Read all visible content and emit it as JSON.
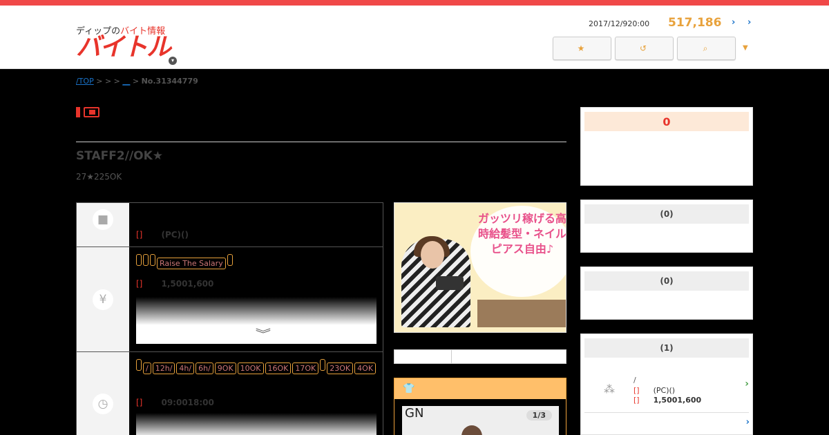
{
  "header": {
    "logo_sub_prefix": "ディップの",
    "logo_sub_red": "バイト情報",
    "logo_main": "バイトル",
    "date": "2017/12/920:00",
    "count": "517,186",
    "buttons": [
      {
        "label": "",
        "icon": "star-icon"
      },
      {
        "label": "",
        "icon": "history-icon"
      },
      {
        "label": "",
        "icon": "search-icon"
      }
    ]
  },
  "breadcrumb": {
    "top": "/TOP",
    "sep": ">",
    "link": "__",
    "current": "No.31344779"
  },
  "job": {
    "title": "STAFF2//OK★",
    "subtitle": "27★225OK"
  },
  "info_rows": {
    "type": {
      "label": "[]",
      "value": "(PC)()"
    },
    "salary": {
      "tags": [
        "",
        "",
        "",
        "Raise The Salary",
        ""
      ],
      "label": "[]",
      "value": "1,5001,600"
    },
    "time": {
      "tags": [
        "",
        "/",
        "12h/",
        "4h/",
        "6h/",
        "9OK",
        "10OK",
        "16OK",
        "17OK",
        "",
        "23OK",
        "4OK"
      ],
      "label": "[]",
      "value": "09:0018:00"
    }
  },
  "photo": {
    "text": "ガッツリ稼げる高時給髪型・ネイルピアス自由♪"
  },
  "gallery": {
    "logo": "GN",
    "count": "1/3"
  },
  "sidebar": {
    "box1_head": "0",
    "box2_head": "(0)",
    "box3_head": "(0)",
    "box4_head": "(1)",
    "item": {
      "line1": "/",
      "line2_label": "[]",
      "line2_value": "(PC)()",
      "line3_label": "[]",
      "line3_value": "1,5001,600"
    }
  },
  "colors": {
    "brand_red": "#e8342b",
    "accent_orange": "#e8a23c",
    "link_blue": "#1a73c9"
  }
}
